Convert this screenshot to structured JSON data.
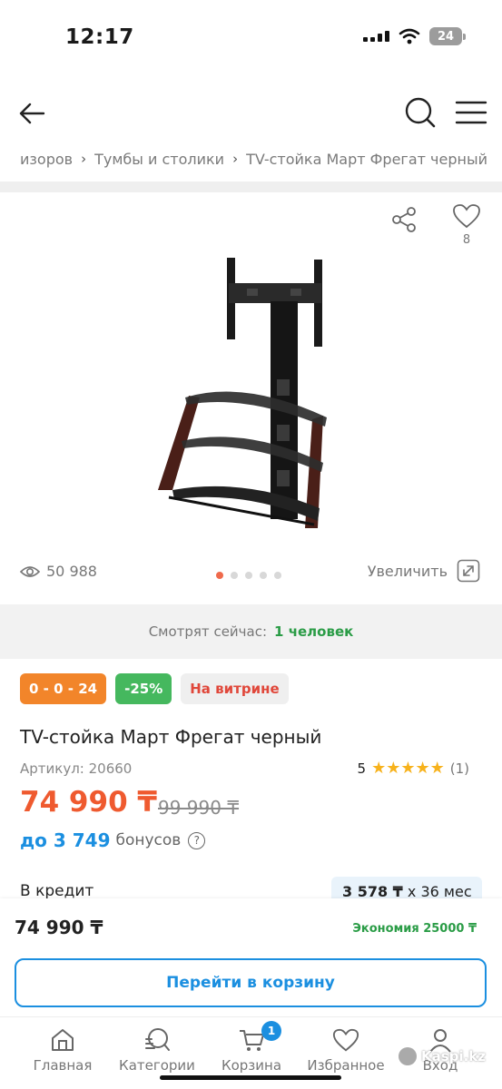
{
  "status": {
    "time": "12:17",
    "battery": "24"
  },
  "breadcrumb": [
    "изоров",
    "Тумбы и столики",
    "TV-стойка Март Фрегат черный"
  ],
  "gallery": {
    "favorites_count": "8",
    "views": "50 988",
    "zoom_label": "Увеличить",
    "image_count": 5,
    "active_image": 1
  },
  "viewing": {
    "label": "Смотрят сейчас:",
    "count": "1 человек"
  },
  "badges": {
    "installment": "0 - 0 - 24",
    "discount": "-25%",
    "showcase": "На витрине"
  },
  "product": {
    "title": "TV-стойка Март Фрегат черный",
    "sku": "Артикул: 20660",
    "rating": "5",
    "stars": "★★★★★",
    "review_count": "(1)",
    "price": "74 990 ₸",
    "old_price": "99 990 ₸",
    "bonus_prefix": "до 3 749",
    "bonus_suffix": "бонусов"
  },
  "credit": {
    "label": "В кредит",
    "amount": "3 578 ₸",
    "term": "x 36 мес"
  },
  "bottom_sheet": {
    "price": "74 990 ₸",
    "saving": "Экономия 25000 ₸",
    "cart_button": "Перейти в корзину"
  },
  "tabbar": {
    "home": "Главная",
    "categories": "Категории",
    "cart": "Корзина",
    "cart_badge": "1",
    "favorites": "Избранное",
    "login": "Вход"
  },
  "watermark": "Kaspi.kz",
  "colors": {
    "accent": "#1b8fe0",
    "price": "#ef5a2f",
    "success": "#2a9c46",
    "star": "#f7b21c"
  }
}
